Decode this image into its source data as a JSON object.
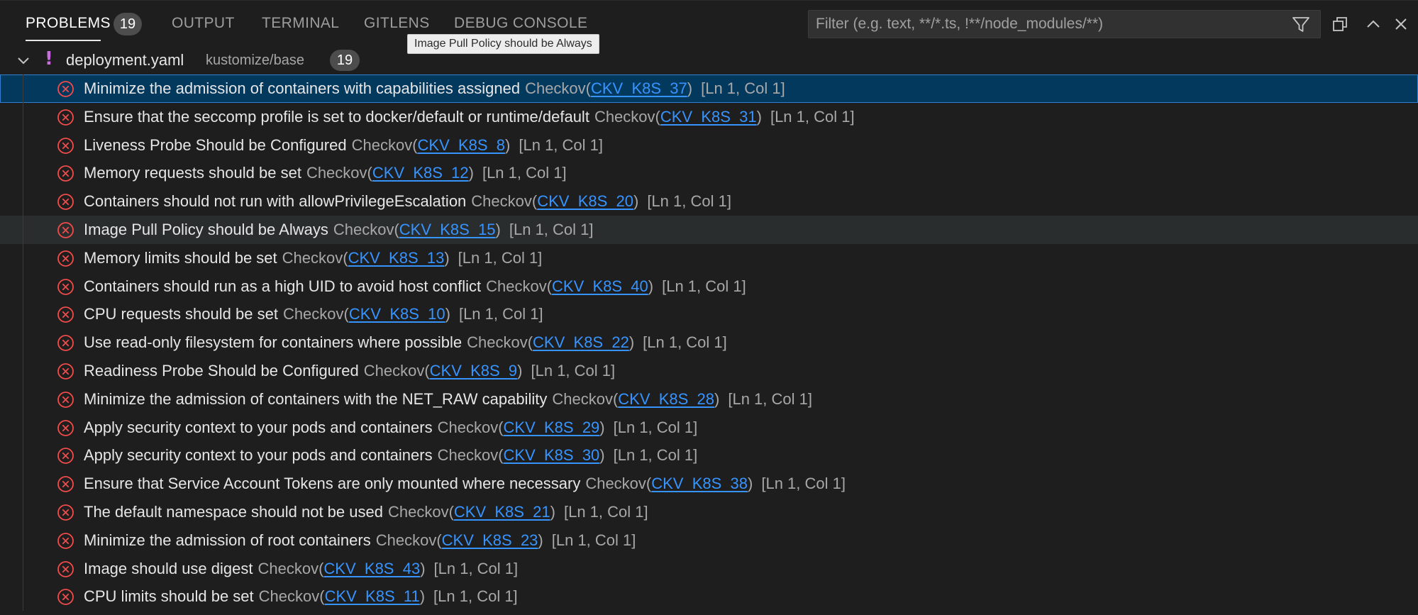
{
  "tabs": [
    {
      "label": "PROBLEMS",
      "active": true
    },
    {
      "label": "OUTPUT",
      "active": false
    },
    {
      "label": "TERMINAL",
      "active": false
    },
    {
      "label": "GITLENS",
      "active": false
    },
    {
      "label": "DEBUG CONSOLE",
      "active": false
    }
  ],
  "problems_count": "19",
  "filter": {
    "placeholder": "Filter (e.g. text, **/*.ts, !**/node_modules/**)",
    "value": ""
  },
  "tooltip": "Image Pull Policy should be Always",
  "icons": {
    "filter": "filter-icon",
    "restore": "restore-panel-icon",
    "maximize": "chevron-up-icon",
    "close": "close-icon",
    "twistie": "chevron-down-icon",
    "warning": "exclamation-icon",
    "error": "error-circle-icon"
  },
  "colors": {
    "background": "#1e1e1e",
    "selection": "#04395e",
    "selection_border": "#2f80d0",
    "error": "#f14c4c",
    "link": "#3794ff",
    "warning_mark": "#cc6ce0"
  },
  "group": {
    "mark": "!",
    "file": "deployment.yaml",
    "path": "kustomize/base",
    "count": "19"
  },
  "problems": [
    {
      "message": "Minimize the admission of containers with capabilities assigned",
      "source": "Checkov",
      "code": "CKV_K8S_37",
      "location": "[Ln 1, Col 1]",
      "state": "selected"
    },
    {
      "message": "Ensure that the seccomp profile is set to docker/default or runtime/default",
      "source": "Checkov",
      "code": "CKV_K8S_31",
      "location": "[Ln 1, Col 1]",
      "state": ""
    },
    {
      "message": "Liveness Probe Should be Configured",
      "source": "Checkov",
      "code": "CKV_K8S_8",
      "location": "[Ln 1, Col 1]",
      "state": ""
    },
    {
      "message": "Memory requests should be set",
      "source": "Checkov",
      "code": "CKV_K8S_12",
      "location": "[Ln 1, Col 1]",
      "state": ""
    },
    {
      "message": "Containers should not run with allowPrivilegeEscalation",
      "source": "Checkov",
      "code": "CKV_K8S_20",
      "location": "[Ln 1, Col 1]",
      "state": ""
    },
    {
      "message": "Image Pull Policy should be Always",
      "source": "Checkov",
      "code": "CKV_K8S_15",
      "location": "[Ln 1, Col 1]",
      "state": "hovered"
    },
    {
      "message": "Memory limits should be set",
      "source": "Checkov",
      "code": "CKV_K8S_13",
      "location": "[Ln 1, Col 1]",
      "state": ""
    },
    {
      "message": "Containers should run as a high UID to avoid host conflict",
      "source": "Checkov",
      "code": "CKV_K8S_40",
      "location": "[Ln 1, Col 1]",
      "state": ""
    },
    {
      "message": "CPU requests should be set",
      "source": "Checkov",
      "code": "CKV_K8S_10",
      "location": "[Ln 1, Col 1]",
      "state": ""
    },
    {
      "message": "Use read-only filesystem for containers where possible",
      "source": "Checkov",
      "code": "CKV_K8S_22",
      "location": "[Ln 1, Col 1]",
      "state": ""
    },
    {
      "message": "Readiness Probe Should be Configured",
      "source": "Checkov",
      "code": "CKV_K8S_9",
      "location": "[Ln 1, Col 1]",
      "state": ""
    },
    {
      "message": "Minimize the admission of containers with the NET_RAW capability",
      "source": "Checkov",
      "code": "CKV_K8S_28",
      "location": "[Ln 1, Col 1]",
      "state": ""
    },
    {
      "message": "Apply security context to your pods and containers",
      "source": "Checkov",
      "code": "CKV_K8S_29",
      "location": "[Ln 1, Col 1]",
      "state": ""
    },
    {
      "message": "Apply security context to your pods and containers",
      "source": "Checkov",
      "code": "CKV_K8S_30",
      "location": "[Ln 1, Col 1]",
      "state": ""
    },
    {
      "message": "Ensure that Service Account Tokens are only mounted where necessary",
      "source": "Checkov",
      "code": "CKV_K8S_38",
      "location": "[Ln 1, Col 1]",
      "state": ""
    },
    {
      "message": "The default namespace should not be used",
      "source": "Checkov",
      "code": "CKV_K8S_21",
      "location": "[Ln 1, Col 1]",
      "state": ""
    },
    {
      "message": "Minimize the admission of root containers",
      "source": "Checkov",
      "code": "CKV_K8S_23",
      "location": "[Ln 1, Col 1]",
      "state": ""
    },
    {
      "message": "Image should use digest",
      "source": "Checkov",
      "code": "CKV_K8S_43",
      "location": "[Ln 1, Col 1]",
      "state": ""
    },
    {
      "message": "CPU limits should be set",
      "source": "Checkov",
      "code": "CKV_K8S_11",
      "location": "[Ln 1, Col 1]",
      "state": ""
    }
  ]
}
